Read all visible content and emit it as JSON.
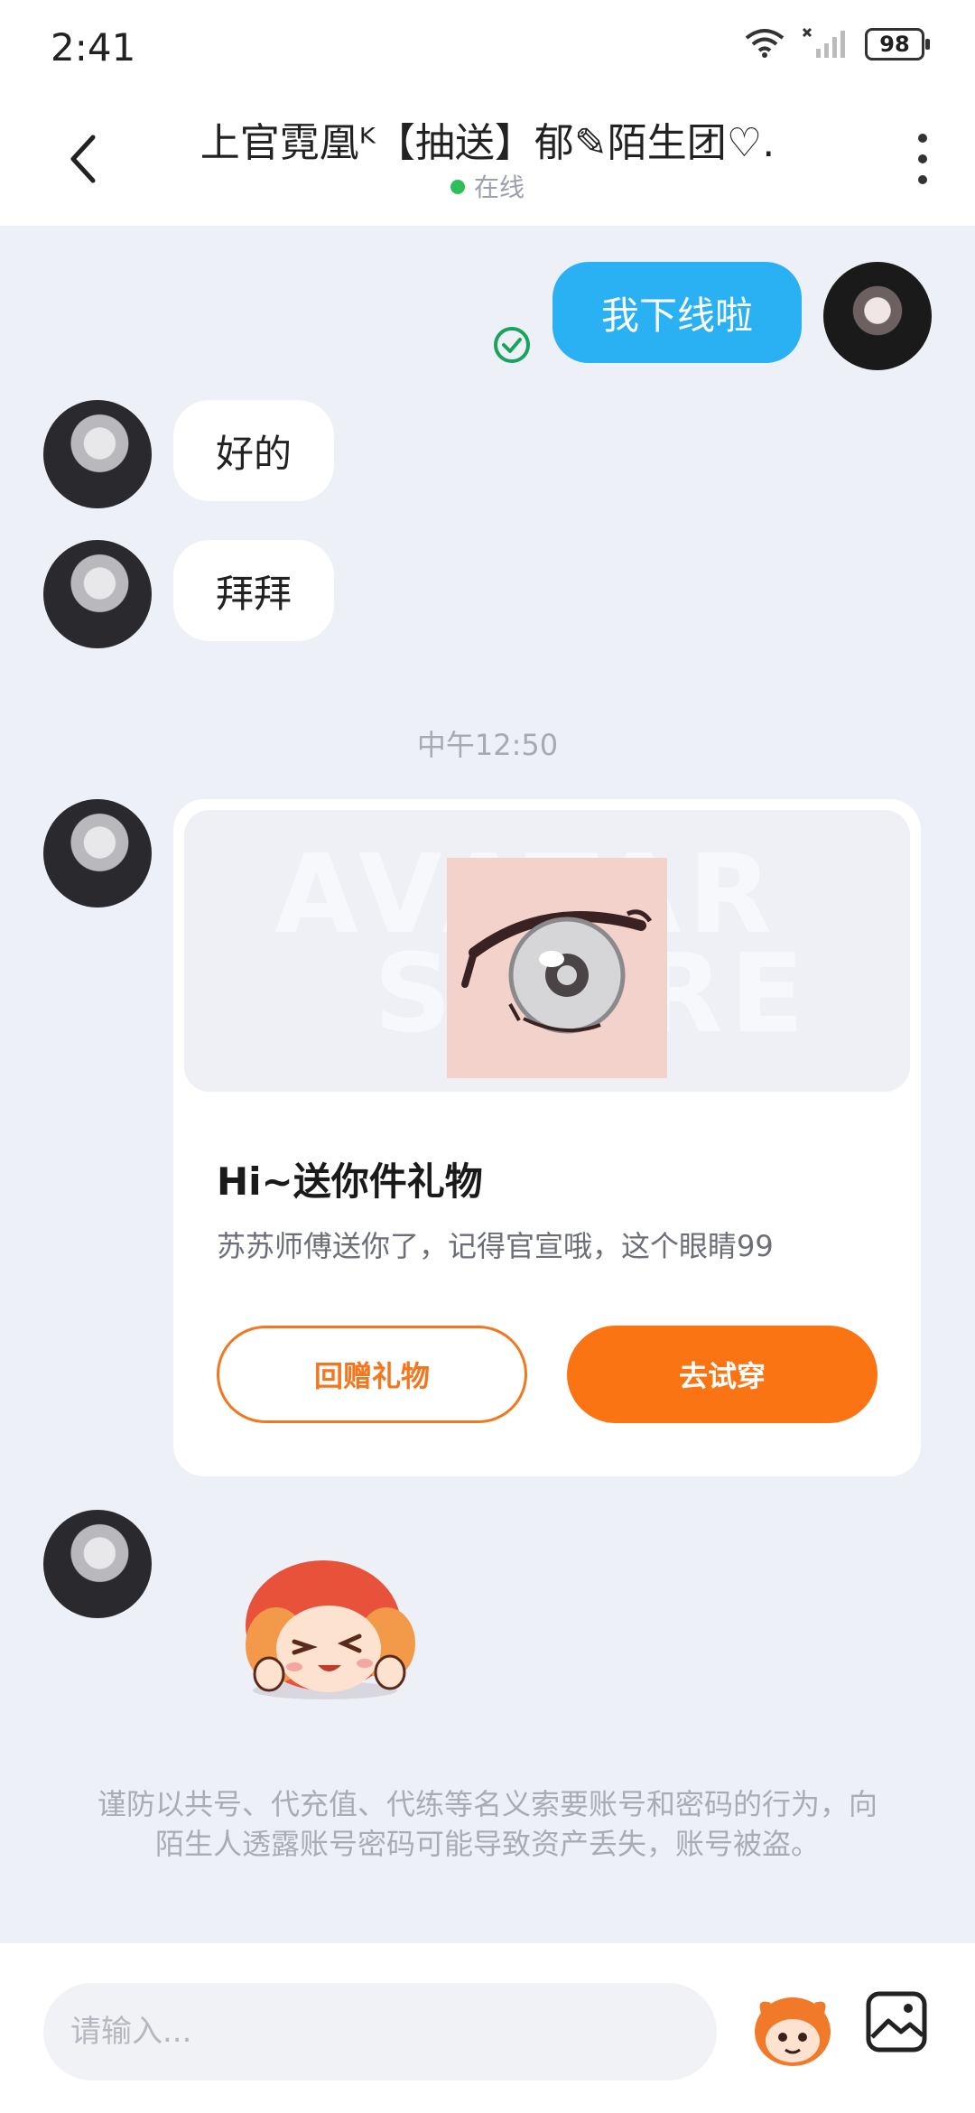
{
  "status_bar": {
    "time": "2:41",
    "battery": "98"
  },
  "header": {
    "title": "上官霓凰ᴷ【抽送】郁✎陌生团♡.",
    "presence": "在线"
  },
  "messages": [
    {
      "from": "me",
      "text": "我下线啦"
    },
    {
      "from": "other",
      "text": "好的"
    },
    {
      "from": "other",
      "text": "拜拜"
    }
  ],
  "time_separator": "中午12:50",
  "gift_card": {
    "watermark_line1": "AVATAR",
    "watermark_line2": "STORE",
    "title": "Hi~送你件礼物",
    "subtitle": "苏苏师傅送你了，记得官宣哦，这个眼睛99",
    "return_gift_label": "回赠礼物",
    "try_on_label": "去试穿"
  },
  "safety_notice": "谨防以共号、代充值、代练等名义索要账号和密码的行为，向陌生人透露账号密码可能导致资产丢失，账号被盗。",
  "composer": {
    "placeholder": "请输入..."
  },
  "colors": {
    "my_bubble": "#2ab1f4",
    "accent_orange": "#fb7413",
    "online_dot": "#2fbf5a",
    "read_check": "#1aa35c"
  }
}
